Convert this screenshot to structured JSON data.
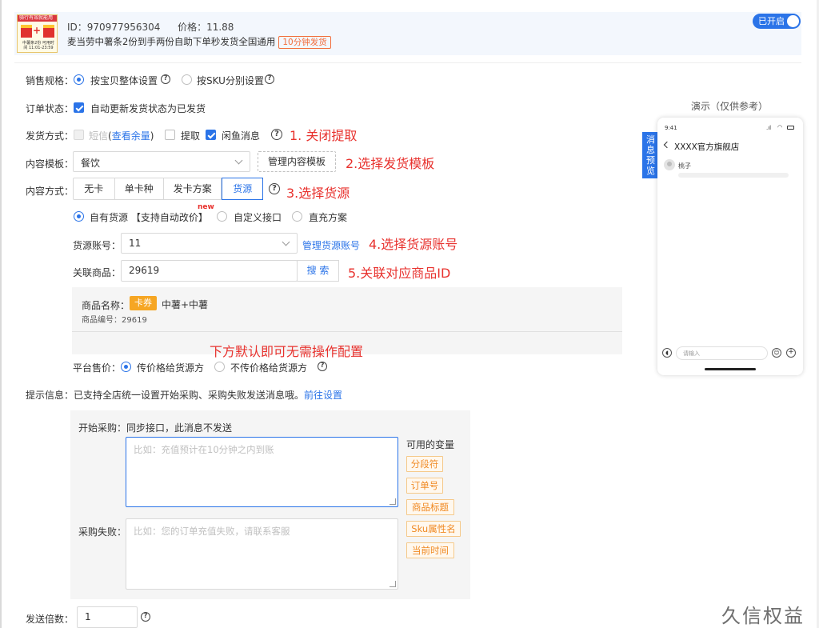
{
  "product": {
    "image_banner": "骑行有效就能用",
    "image_caption": "中薯条2份 可用时间 11:01-23:59",
    "id_label": "ID：",
    "id_value": "970977956304",
    "price_label": "价格：",
    "price_value": "11.88",
    "title": "麦当劳中薯条2份到手两份自助下单秒发货全国通用",
    "delivery_tag": "10分钟发货",
    "toggle_label": "已开启"
  },
  "form": {
    "sales_spec": {
      "label": "销售规格：",
      "options": [
        "按宝贝整体设置",
        "按SKU分别设置"
      ],
      "selected": "按宝贝整体设置"
    },
    "order_status": {
      "label": "订单状态：",
      "checkbox_label": "自动更新发货状态为已发货",
      "checked": true
    },
    "delivery_method": {
      "label": "发货方式：",
      "sms_label": "短信",
      "balance_link": "查看余量",
      "pickup_label": "提取",
      "xianyu_label": "闲鱼消息",
      "xianyu_checked": true,
      "pickup_checked": false
    },
    "content_template": {
      "label": "内容模板：",
      "value": "餐饮",
      "manage_button": "管理内容模板"
    },
    "content_method": {
      "label": "内容方式：",
      "tabs": [
        "无卡",
        "单卡种",
        "发卡方案",
        "货源"
      ],
      "selected": "货源"
    },
    "source_type": {
      "options": [
        "自有货源",
        "自定义接口",
        "直充方案"
      ],
      "own_suffix": "【支持自动改价】",
      "new_badge": "new",
      "selected": "自有货源"
    },
    "source_account": {
      "label": "货源账号：",
      "value": "11",
      "manage_link": "管理货源账号"
    },
    "linked_product": {
      "label": "关联商品：",
      "value": "29619",
      "search_button": "搜 索"
    },
    "product_info": {
      "name_label": "商品名称：",
      "type_badge": "卡券",
      "name_value": "中薯+中薯",
      "code_label": "商品编号：",
      "code_value": "29619"
    },
    "platform_price": {
      "label": "平台售价：",
      "options": [
        "传价格给货源方",
        "不传价格给货源方"
      ],
      "selected": "传价格给货源方"
    },
    "tip_info": {
      "label": "提示信息：",
      "text": "已支持全店统一设置开始采购、采购失败发送消息哦。",
      "link": "前往设置"
    },
    "purchase": {
      "start_label": "开始采购：",
      "start_note": "同步接口，此消息不发送",
      "start_placeholder": "比如：充值预计在10分钟之内到账",
      "fail_label": "采购失败：",
      "fail_placeholder": "比如：您的订单充值失败，请联系客服",
      "vars_title": "可用的变量",
      "vars": [
        "分段符",
        "订单号",
        "商品标题",
        "Sku属性名",
        "当前时间"
      ]
    },
    "send_multiple": {
      "label": "发送倍数：",
      "value": "1"
    }
  },
  "annotations": {
    "a1": "1. 关闭提取",
    "a2": "2.选择发货模板",
    "a3": "3.选择货源",
    "a4": "4.选择货源账号",
    "a5": "5.关联对应商品ID",
    "default_note": "下方默认即可无需操作配置"
  },
  "preview": {
    "title": "演示（仅供参考）",
    "side_tab": "消息预览",
    "time": "9:41",
    "shop_name": "XXXX官方旗舰店",
    "user_name": "桃子",
    "input_placeholder": "请输入"
  },
  "watermark": "久信权益",
  "colors": {
    "primary": "#2b74e8",
    "annotation_red": "#e8322e",
    "tag_orange": "#f08a24"
  }
}
